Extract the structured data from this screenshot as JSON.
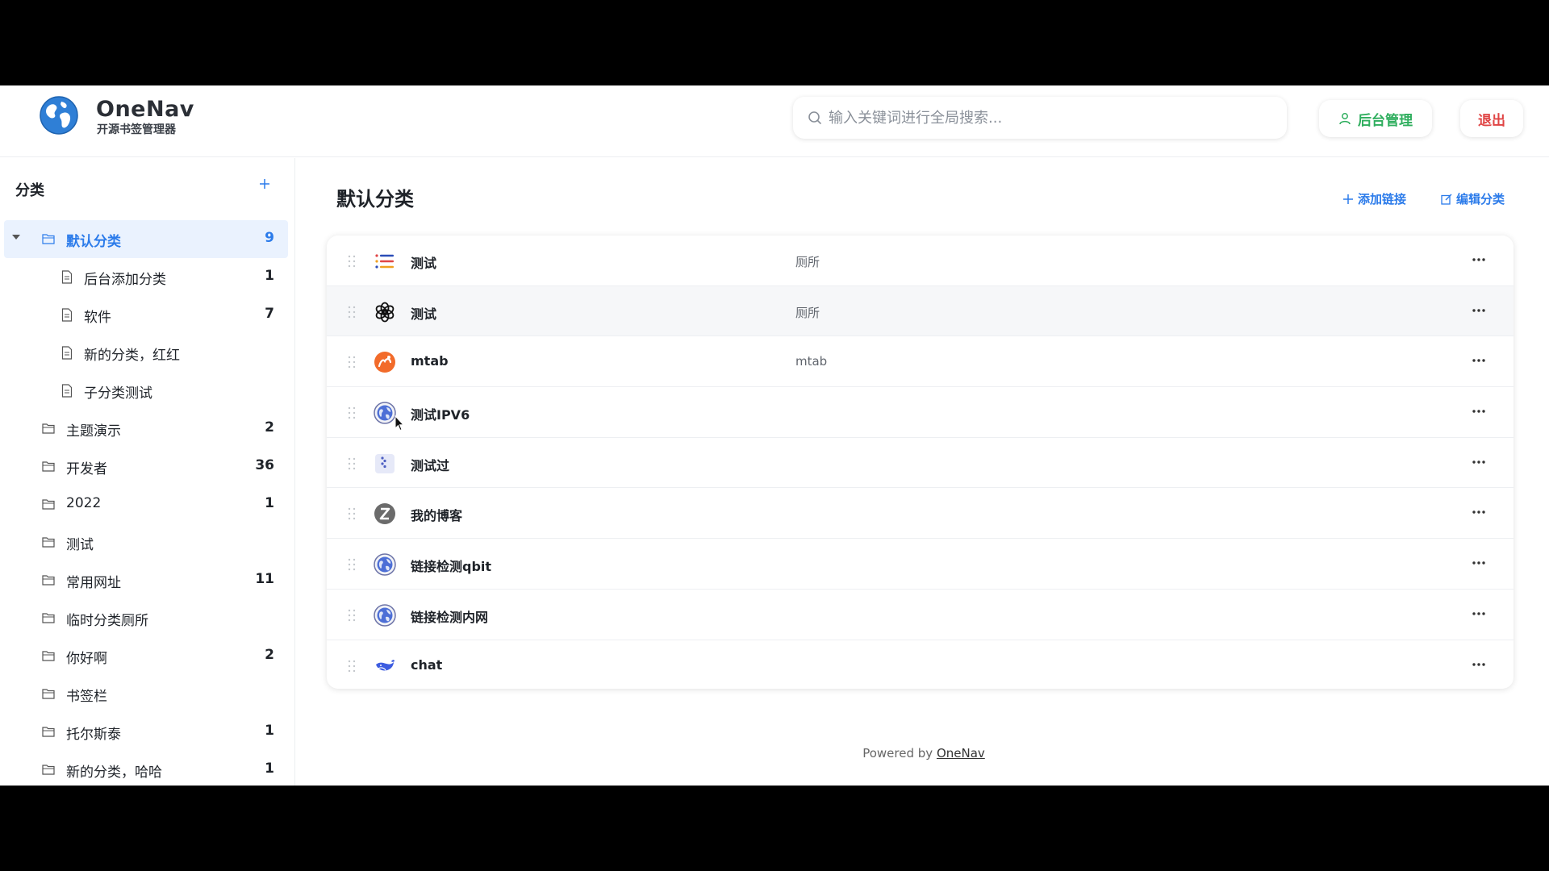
{
  "header": {
    "brand_name": "OneNav",
    "brand_subtitle": "开源书签管理器",
    "search_placeholder": "输入关键词进行全局搜索...",
    "admin_label": "后台管理",
    "logout_label": "退出"
  },
  "sidebar": {
    "title": "分类",
    "items": [
      {
        "label": "默认分类",
        "count": "9",
        "level": 0,
        "active": true,
        "expanded": true
      },
      {
        "label": "后台添加分类",
        "count": "1",
        "level": 1
      },
      {
        "label": "软件",
        "count": "7",
        "level": 1
      },
      {
        "label": "新的分类，红红",
        "count": "",
        "level": 1
      },
      {
        "label": "子分类测试",
        "count": "",
        "level": 1
      },
      {
        "label": "主题演示",
        "count": "2",
        "level": 0
      },
      {
        "label": "开发者",
        "count": "36",
        "level": 0
      },
      {
        "label": "2022",
        "count": "1",
        "level": 0
      },
      {
        "label": "测试",
        "count": "",
        "level": 0
      },
      {
        "label": "常用网址",
        "count": "11",
        "level": 0
      },
      {
        "label": "临时分类厕所",
        "count": "",
        "level": 0
      },
      {
        "label": "你好啊",
        "count": "2",
        "level": 0
      },
      {
        "label": "书签栏",
        "count": "",
        "level": 0
      },
      {
        "label": "托尔斯泰",
        "count": "1",
        "level": 0
      },
      {
        "label": "新的分类，哈哈",
        "count": "1",
        "level": 0
      }
    ]
  },
  "main": {
    "title": "默认分类",
    "add_link_label": "添加链接",
    "edit_category_label": "编辑分类",
    "links": [
      {
        "name": "测试",
        "desc": "厕所",
        "icon": "list-icon"
      },
      {
        "name": "测试",
        "desc": "厕所",
        "icon": "openai-icon"
      },
      {
        "name": "mtab",
        "desc": "mtab",
        "icon": "mtab-icon"
      },
      {
        "name": "测试IPV6",
        "desc": "",
        "icon": "globe-icon"
      },
      {
        "name": "测试过",
        "desc": "",
        "icon": "dots-icon"
      },
      {
        "name": "我的博客",
        "desc": "",
        "icon": "z-blog-icon"
      },
      {
        "name": "链接检测qbit",
        "desc": "",
        "icon": "globe-icon"
      },
      {
        "name": "链接检测内网",
        "desc": "",
        "icon": "globe-icon"
      },
      {
        "name": "chat",
        "desc": "",
        "icon": "whale-icon"
      }
    ]
  },
  "footer": {
    "powered_by": "Powered by",
    "link_text": "OneNav"
  },
  "colors": {
    "accent": "#2b7bea",
    "admin_green": "#2fae5e",
    "logout_red": "#e04545",
    "active_bg": "#eaf2fe"
  }
}
